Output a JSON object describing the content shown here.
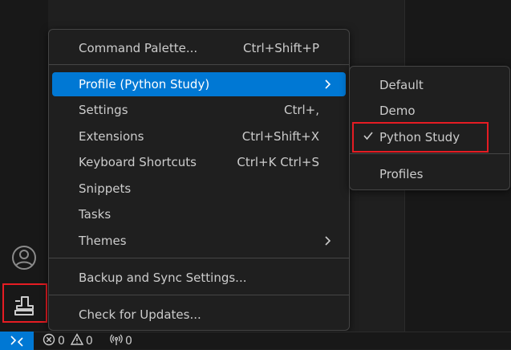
{
  "menu": {
    "items": [
      {
        "label": "Command Palette...",
        "shortcut": "Ctrl+Shift+P"
      },
      {
        "label": "Profile (Python Study)"
      },
      {
        "label": "Settings",
        "shortcut": "Ctrl+,"
      },
      {
        "label": "Extensions",
        "shortcut": "Ctrl+Shift+X"
      },
      {
        "label": "Keyboard Shortcuts",
        "shortcut": "Ctrl+K Ctrl+S"
      },
      {
        "label": "Snippets"
      },
      {
        "label": "Tasks"
      },
      {
        "label": "Themes"
      },
      {
        "label": "Backup and Sync Settings..."
      },
      {
        "label": "Check for Updates..."
      }
    ]
  },
  "submenu": {
    "items": [
      {
        "label": "Default"
      },
      {
        "label": "Demo"
      },
      {
        "label": "Python Study",
        "checked": true
      },
      {
        "label": "Profiles"
      }
    ]
  },
  "status": {
    "errors": "0",
    "warnings": "0",
    "ports": "0"
  },
  "icons": {
    "accounts": "account-icon",
    "manage": "manage-profile-icon",
    "remote": "remote-icon",
    "error": "error-icon",
    "warning": "warning-icon",
    "ports": "broadcast-icon",
    "submenu": "chevron-right-icon",
    "check": "check-icon"
  },
  "colors": {
    "selection": "#0078d4",
    "highlight": "#e51c23",
    "menu_bg": "#1f1f1f",
    "activity_bg": "#181818"
  }
}
